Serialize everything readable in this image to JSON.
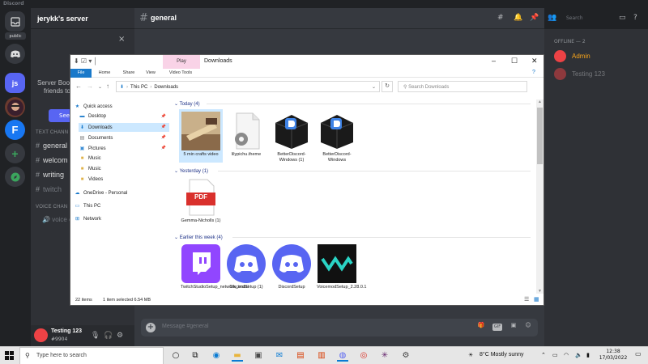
{
  "discord": {
    "app_title": "Discord",
    "rail": {
      "public_label": "public",
      "js_label": "js",
      "f_label": "F"
    },
    "server_name": "jerykk's server",
    "boost": {
      "text_line1": "Server Boos",
      "text_line2": "friends to",
      "button": "See"
    },
    "categories": {
      "text": "TEXT CHANN",
      "voice": "VOICE CHAN"
    },
    "channels": [
      {
        "name": "general"
      },
      {
        "name": "welcom"
      },
      {
        "name": "writing"
      },
      {
        "name": "twitch"
      }
    ],
    "voice_channel": "voice ch",
    "user": {
      "name": "Testing 123",
      "tag": "#9904"
    },
    "chat": {
      "channel": "general",
      "search_placeholder": "Search",
      "message_placeholder": "Message #general",
      "gif_label": "GIF"
    },
    "members": {
      "category": "OFFLINE — 2",
      "list": [
        {
          "name": "Admin",
          "color": "#faa61a"
        },
        {
          "name": "Testing 123",
          "color": "#72767d"
        }
      ]
    }
  },
  "explorer": {
    "title": "Downloads",
    "context_tab": "Play",
    "ribbon_tabs": [
      "File",
      "Home",
      "Share",
      "View",
      "Video Tools"
    ],
    "address": {
      "segments": [
        "This PC",
        "Downloads"
      ]
    },
    "search_placeholder": "Search Downloads",
    "nav": [
      {
        "label": "Quick access",
        "icon": "star-icon",
        "level": 0
      },
      {
        "label": "Desktop",
        "icon": "desktop-icon",
        "level": 1,
        "pinned": true
      },
      {
        "label": "Downloads",
        "icon": "download-icon",
        "level": 1,
        "pinned": true,
        "selected": true
      },
      {
        "label": "Documents",
        "icon": "document-icon",
        "level": 1,
        "pinned": true
      },
      {
        "label": "Pictures",
        "icon": "picture-icon",
        "level": 1,
        "pinned": true
      },
      {
        "label": "Music",
        "icon": "folder-icon",
        "level": 1
      },
      {
        "label": "Music",
        "icon": "folder-icon",
        "level": 1
      },
      {
        "label": "Videos",
        "icon": "folder-icon",
        "level": 1
      },
      {
        "label": "OneDrive - Personal",
        "icon": "cloud-icon",
        "level": 0
      },
      {
        "label": "This PC",
        "icon": "computer-icon",
        "level": 0
      },
      {
        "label": "Network",
        "icon": "network-icon",
        "level": 0
      }
    ],
    "groups": [
      {
        "label": "Today (4)",
        "items": [
          {
            "name": "5 min crafts video",
            "kind": "video",
            "selected": true
          },
          {
            "name": "lilypichu.theme",
            "kind": "theme"
          },
          {
            "name": "BetterDiscord-Windows (1)",
            "kind": "installer"
          },
          {
            "name": "BetterDiscord-Windows",
            "kind": "installer"
          }
        ]
      },
      {
        "label": "Yesterday (1)",
        "items": [
          {
            "name": "Gemma-Nicholls (1)",
            "kind": "pdf"
          }
        ]
      },
      {
        "label": "Earlier this week (4)",
        "items": [
          {
            "name": "TwitchStudioSetup_network_instal",
            "kind": "twitch"
          },
          {
            "name": "DiscordSetup (1)",
            "kind": "discord"
          },
          {
            "name": "DiscordSetup",
            "kind": "discord"
          },
          {
            "name": "VoicemodSetup_2.28.0.1",
            "kind": "voicemod"
          }
        ]
      }
    ],
    "pdf_label": "PDF",
    "status": {
      "count": "22 items",
      "selection": "1 item selected  6.54 MB"
    }
  },
  "taskbar": {
    "search_placeholder": "Type here to search",
    "weather": "8°C  Mostly sunny",
    "time": "12:38",
    "date": "17/03/2022"
  }
}
